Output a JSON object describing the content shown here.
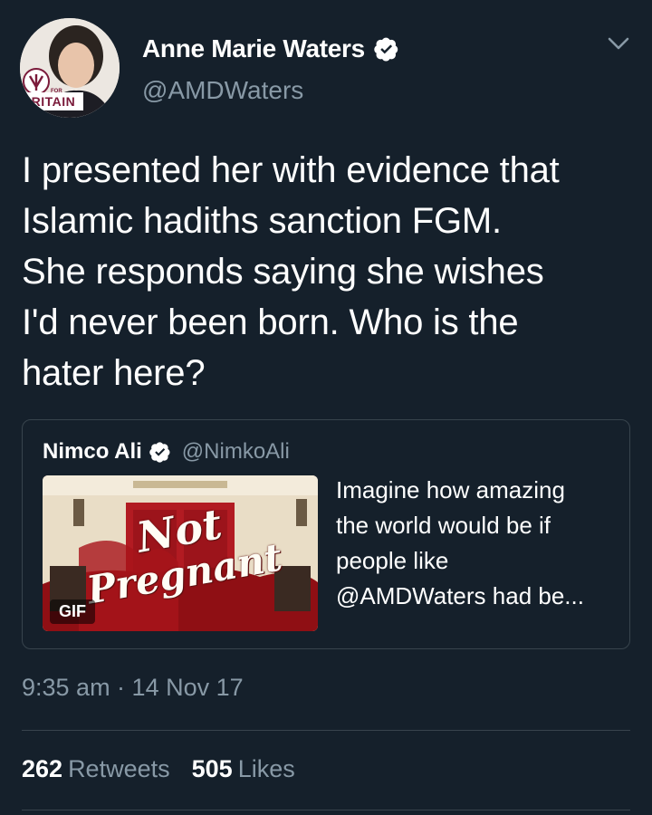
{
  "author": {
    "name": "Anne Marie Waters",
    "handle": "@AMDWaters",
    "avatar_badge": "BRITAIN",
    "avatar_badge_small": "FOR"
  },
  "tweet": {
    "text": "I presented her with evidence that\nIslamic hadiths sanction FGM.\nShe responds  saying she wishes\nI'd never been born.  Who is the\nhater here?"
  },
  "quoted": {
    "name": "Nimco Ali",
    "handle": "@NimkoAli",
    "text": "Imagine how amazing\nthe world would be if\npeople like\n@AMDWaters had be...",
    "media_badge": "GIF",
    "media_caption_line1": "Not",
    "media_caption_line2": "Pregnant"
  },
  "meta": {
    "timestamp": "9:35 am · 14 Nov 17"
  },
  "stats": {
    "retweets_count": "262",
    "retweets_label": "Retweets",
    "likes_count": "505",
    "likes_label": "Likes"
  },
  "colors": {
    "background": "#15202b",
    "secondary_text": "#8899a6",
    "verified_blue": "#ffffff",
    "border": "#38444d"
  }
}
